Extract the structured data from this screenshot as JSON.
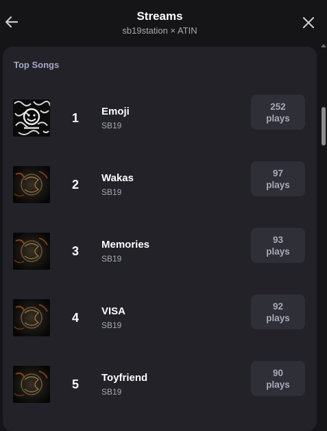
{
  "header": {
    "title": "Streams",
    "subtitle": "sb19station × ATIN",
    "back_icon": "arrow-left-icon",
    "close_icon": "close-icon"
  },
  "panel": {
    "title": "Top Songs"
  },
  "songs": [
    {
      "rank": "1",
      "title": "Emoji",
      "artist": "SB19",
      "plays_count": "252",
      "plays_label": "plays",
      "cover": "emoji-cover"
    },
    {
      "rank": "2",
      "title": "Wakas",
      "artist": "SB19",
      "plays_count": "97",
      "plays_label": "plays",
      "cover": "album-cover"
    },
    {
      "rank": "3",
      "title": "Memories",
      "artist": "SB19",
      "plays_count": "93",
      "plays_label": "plays",
      "cover": "album-cover"
    },
    {
      "rank": "4",
      "title": "VISA",
      "artist": "SB19",
      "plays_count": "92",
      "plays_label": "plays",
      "cover": "album-cover"
    },
    {
      "rank": "5",
      "title": "Toyfriend",
      "artist": "SB19",
      "plays_count": "90",
      "plays_label": "plays",
      "cover": "album-cover"
    }
  ],
  "colors": {
    "background": "#151518",
    "panel": "#222228",
    "plays_box": "#2e2f37",
    "muted_text": "#a9a9b2",
    "section_title": "#a5a7c8"
  }
}
